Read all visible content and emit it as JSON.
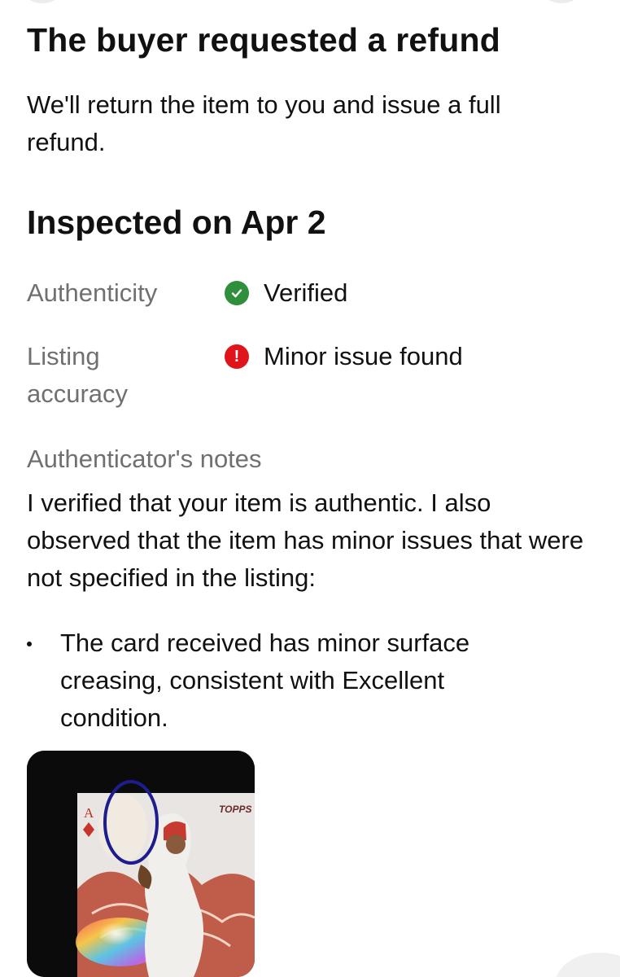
{
  "header": {
    "title": "The buyer requested a refund",
    "subtitle": "We'll return the item to you and issue a full refund."
  },
  "inspection": {
    "heading": "Inspected on Apr 2",
    "rows": [
      {
        "label": "Authenticity",
        "value": "Verified",
        "status": "verified",
        "icon": "check-circle-icon",
        "color": "#2f8f3a"
      },
      {
        "label": "Listing accuracy",
        "value": "Minor issue found",
        "status": "issue",
        "icon": "exclamation-circle-icon",
        "color": "#e0141b"
      }
    ]
  },
  "notes": {
    "label": "Authenticator's notes",
    "text": "I verified that your item is authentic. I also observed that the item has minor issues that were not specified in the listing:",
    "bullets": [
      "The card received has minor surface creasing, consistent with Excellent condition."
    ]
  },
  "photo": {
    "card_rank": "A",
    "brand_mark": "TOPPS"
  }
}
